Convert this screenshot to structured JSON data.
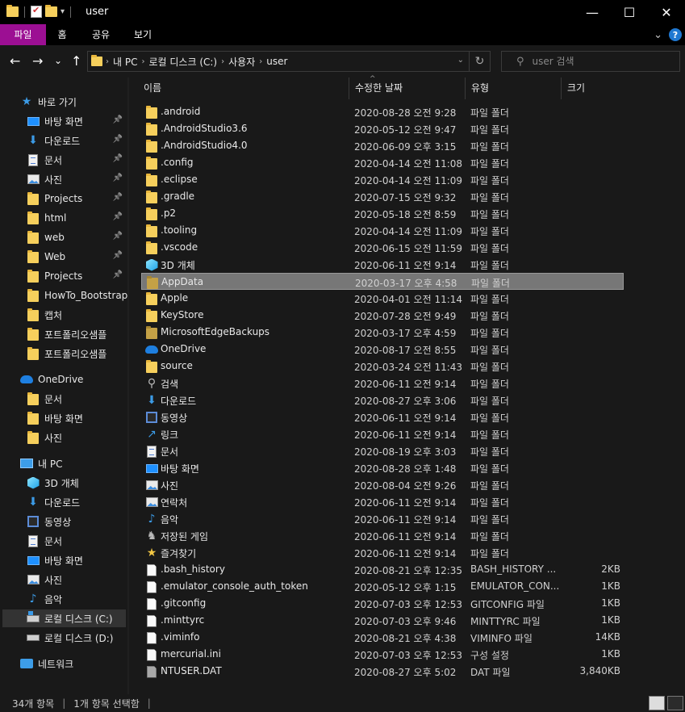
{
  "window": {
    "title": "user",
    "minimize_glyph": "—",
    "maximize_glyph": "☐",
    "close_glyph": "✕"
  },
  "ribbon": {
    "tabs": [
      "파일",
      "홈",
      "공유",
      "보기"
    ],
    "active_tab": "파일",
    "accent_color": "#9c0f93",
    "expand_glyph": "⌄",
    "help_glyph": "?"
  },
  "address": {
    "back_glyph": "←",
    "forward_glyph": "→",
    "recent_glyph": "⌄",
    "up_glyph": "↑",
    "crumbs": [
      "내 PC",
      "로컬 디스크 (C:)",
      "사용자",
      "user"
    ],
    "refresh_glyph": "↻",
    "dropdown_glyph": "⌄"
  },
  "search": {
    "placeholder": "user 검색",
    "icon": "search-icon",
    "glyph": "⚲"
  },
  "nav": {
    "items": [
      {
        "label": "바로 가기",
        "icon": "star-icon",
        "pinned": false,
        "indent": 1
      },
      {
        "label": "바탕 화면",
        "icon": "desktop-icon",
        "pinned": true,
        "indent": 2
      },
      {
        "label": "다운로드",
        "icon": "download-icon",
        "pinned": true,
        "indent": 2
      },
      {
        "label": "문서",
        "icon": "document-icon",
        "pinned": true,
        "indent": 2
      },
      {
        "label": "사진",
        "icon": "pictures-icon",
        "pinned": true,
        "indent": 2
      },
      {
        "label": "Projects",
        "icon": "folder-icon",
        "pinned": true,
        "indent": 2
      },
      {
        "label": "html",
        "icon": "folder-icon",
        "pinned": true,
        "indent": 2
      },
      {
        "label": "web",
        "icon": "folder-icon",
        "pinned": true,
        "indent": 2
      },
      {
        "label": "Web",
        "icon": "folder-icon",
        "pinned": true,
        "indent": 2
      },
      {
        "label": "Projects",
        "icon": "folder-icon",
        "pinned": true,
        "indent": 2
      },
      {
        "label": "HowTo_Bootstrap",
        "icon": "folder-icon",
        "pinned": false,
        "indent": 2
      },
      {
        "label": "캡처",
        "icon": "folder-icon",
        "pinned": false,
        "indent": 2
      },
      {
        "label": "포트폴리오샘플",
        "icon": "folder-icon",
        "pinned": false,
        "indent": 2
      },
      {
        "label": "포트폴리오샘플",
        "icon": "folder-icon",
        "pinned": false,
        "indent": 2
      },
      {
        "label": "OneDrive",
        "icon": "onedrive-icon",
        "pinned": false,
        "indent": 1
      },
      {
        "label": "문서",
        "icon": "folder-icon",
        "pinned": false,
        "indent": 2
      },
      {
        "label": "바탕 화면",
        "icon": "folder-icon",
        "pinned": false,
        "indent": 2
      },
      {
        "label": "사진",
        "icon": "folder-icon",
        "pinned": false,
        "indent": 2
      },
      {
        "label": "내 PC",
        "icon": "pc-icon",
        "pinned": false,
        "indent": 1
      },
      {
        "label": "3D 개체",
        "icon": "cube-icon",
        "pinned": false,
        "indent": 2
      },
      {
        "label": "다운로드",
        "icon": "download-icon",
        "pinned": false,
        "indent": 2
      },
      {
        "label": "동영상",
        "icon": "video-icon",
        "pinned": false,
        "indent": 2
      },
      {
        "label": "문서",
        "icon": "document-icon",
        "pinned": false,
        "indent": 2
      },
      {
        "label": "바탕 화면",
        "icon": "desktop-icon",
        "pinned": false,
        "indent": 2
      },
      {
        "label": "사진",
        "icon": "pictures-icon",
        "pinned": false,
        "indent": 2
      },
      {
        "label": "음악",
        "icon": "music-icon",
        "pinned": false,
        "indent": 2
      },
      {
        "label": "로컬 디스크 (C:)",
        "icon": "system-drive-icon",
        "pinned": false,
        "indent": 2,
        "selected": true
      },
      {
        "label": "로컬 디스크 (D:)",
        "icon": "drive-icon",
        "pinned": false,
        "indent": 2
      },
      {
        "label": "네트워크",
        "icon": "network-icon",
        "pinned": false,
        "indent": 1
      }
    ]
  },
  "columns": {
    "name": "이름",
    "modified": "수정한 날짜",
    "type": "유형",
    "size": "크기",
    "sort_glyph": "^"
  },
  "files": [
    {
      "name": ".android",
      "date": "2020-08-28 오전 9:28",
      "type": "파일 폴더",
      "size": "",
      "icon": "folder-icon"
    },
    {
      "name": ".AndroidStudio3.6",
      "date": "2020-05-12 오전 9:47",
      "type": "파일 폴더",
      "size": "",
      "icon": "folder-icon"
    },
    {
      "name": ".AndroidStudio4.0",
      "date": "2020-06-09 오후 3:15",
      "type": "파일 폴더",
      "size": "",
      "icon": "folder-icon"
    },
    {
      "name": ".config",
      "date": "2020-04-14 오전 11:08",
      "type": "파일 폴더",
      "size": "",
      "icon": "folder-icon"
    },
    {
      "name": ".eclipse",
      "date": "2020-04-14 오전 11:09",
      "type": "파일 폴더",
      "size": "",
      "icon": "folder-icon"
    },
    {
      "name": ".gradle",
      "date": "2020-07-15 오전 9:32",
      "type": "파일 폴더",
      "size": "",
      "icon": "folder-icon"
    },
    {
      "name": ".p2",
      "date": "2020-05-18 오전 8:59",
      "type": "파일 폴더",
      "size": "",
      "icon": "folder-icon"
    },
    {
      "name": ".tooling",
      "date": "2020-04-14 오전 11:09",
      "type": "파일 폴더",
      "size": "",
      "icon": "folder-icon"
    },
    {
      "name": ".vscode",
      "date": "2020-06-15 오전 11:59",
      "type": "파일 폴더",
      "size": "",
      "icon": "folder-icon"
    },
    {
      "name": "3D 개체",
      "date": "2020-06-11 오전 9:14",
      "type": "파일 폴더",
      "size": "",
      "icon": "cube-icon"
    },
    {
      "name": "AppData",
      "date": "2020-03-17 오후 4:58",
      "type": "파일 폴더",
      "size": "",
      "icon": "hidden-folder-icon",
      "selected": true
    },
    {
      "name": "Apple",
      "date": "2020-04-01 오전 11:14",
      "type": "파일 폴더",
      "size": "",
      "icon": "folder-icon"
    },
    {
      "name": "KeyStore",
      "date": "2020-07-28 오전 9:49",
      "type": "파일 폴더",
      "size": "",
      "icon": "folder-icon"
    },
    {
      "name": "MicrosoftEdgeBackups",
      "date": "2020-03-17 오후 4:59",
      "type": "파일 폴더",
      "size": "",
      "icon": "hidden-folder-icon"
    },
    {
      "name": "OneDrive",
      "date": "2020-08-17 오전 8:55",
      "type": "파일 폴더",
      "size": "",
      "icon": "onedrive-icon"
    },
    {
      "name": "source",
      "date": "2020-03-24 오전 11:43",
      "type": "파일 폴더",
      "size": "",
      "icon": "folder-icon"
    },
    {
      "name": "검색",
      "date": "2020-06-11 오전 9:14",
      "type": "파일 폴더",
      "size": "",
      "icon": "search-icon"
    },
    {
      "name": "다운로드",
      "date": "2020-08-27 오후 3:06",
      "type": "파일 폴더",
      "size": "",
      "icon": "download-icon"
    },
    {
      "name": "동영상",
      "date": "2020-06-11 오전 9:14",
      "type": "파일 폴더",
      "size": "",
      "icon": "video-icon"
    },
    {
      "name": "링크",
      "date": "2020-06-11 오전 9:14",
      "type": "파일 폴더",
      "size": "",
      "icon": "link-icon"
    },
    {
      "name": "문서",
      "date": "2020-08-19 오후 3:03",
      "type": "파일 폴더",
      "size": "",
      "icon": "document-icon"
    },
    {
      "name": "바탕 화면",
      "date": "2020-08-28 오후 1:48",
      "type": "파일 폴더",
      "size": "",
      "icon": "desktop-icon"
    },
    {
      "name": "사진",
      "date": "2020-08-04 오전 9:26",
      "type": "파일 폴더",
      "size": "",
      "icon": "pictures-icon"
    },
    {
      "name": "연락처",
      "date": "2020-06-11 오전 9:14",
      "type": "파일 폴더",
      "size": "",
      "icon": "contacts-icon"
    },
    {
      "name": "음악",
      "date": "2020-06-11 오전 9:14",
      "type": "파일 폴더",
      "size": "",
      "icon": "music-icon"
    },
    {
      "name": "저장된 게임",
      "date": "2020-06-11 오전 9:14",
      "type": "파일 폴더",
      "size": "",
      "icon": "saved-games-icon"
    },
    {
      "name": "즐겨찾기",
      "date": "2020-06-11 오전 9:14",
      "type": "파일 폴더",
      "size": "",
      "icon": "favorites-star-icon"
    },
    {
      "name": ".bash_history",
      "date": "2020-08-21 오후 12:35",
      "type": "BASH_HISTORY ...",
      "size": "2KB",
      "icon": "file-icon"
    },
    {
      "name": ".emulator_console_auth_token",
      "date": "2020-05-12 오후 1:15",
      "type": "EMULATOR_CON...",
      "size": "1KB",
      "icon": "file-icon"
    },
    {
      "name": ".gitconfig",
      "date": "2020-07-03 오후 12:53",
      "type": "GITCONFIG 파일",
      "size": "1KB",
      "icon": "file-icon"
    },
    {
      "name": ".minttyrc",
      "date": "2020-07-03 오후 9:46",
      "type": "MINTTYRC 파일",
      "size": "1KB",
      "icon": "file-icon"
    },
    {
      "name": ".viminfo",
      "date": "2020-08-21 오후 4:38",
      "type": "VIMINFO 파일",
      "size": "14KB",
      "icon": "file-icon"
    },
    {
      "name": "mercurial.ini",
      "date": "2020-07-03 오후 12:53",
      "type": "구성 설정",
      "size": "1KB",
      "icon": "config-file-icon"
    },
    {
      "name": "NTUSER.DAT",
      "date": "2020-08-27 오후 5:02",
      "type": "DAT 파일",
      "size": "3,840KB",
      "icon": "system-file-icon"
    }
  ],
  "status": {
    "count": "34개 항목",
    "selection": "1개 항목 선택함",
    "separator": "|",
    "separator_end": "|"
  }
}
